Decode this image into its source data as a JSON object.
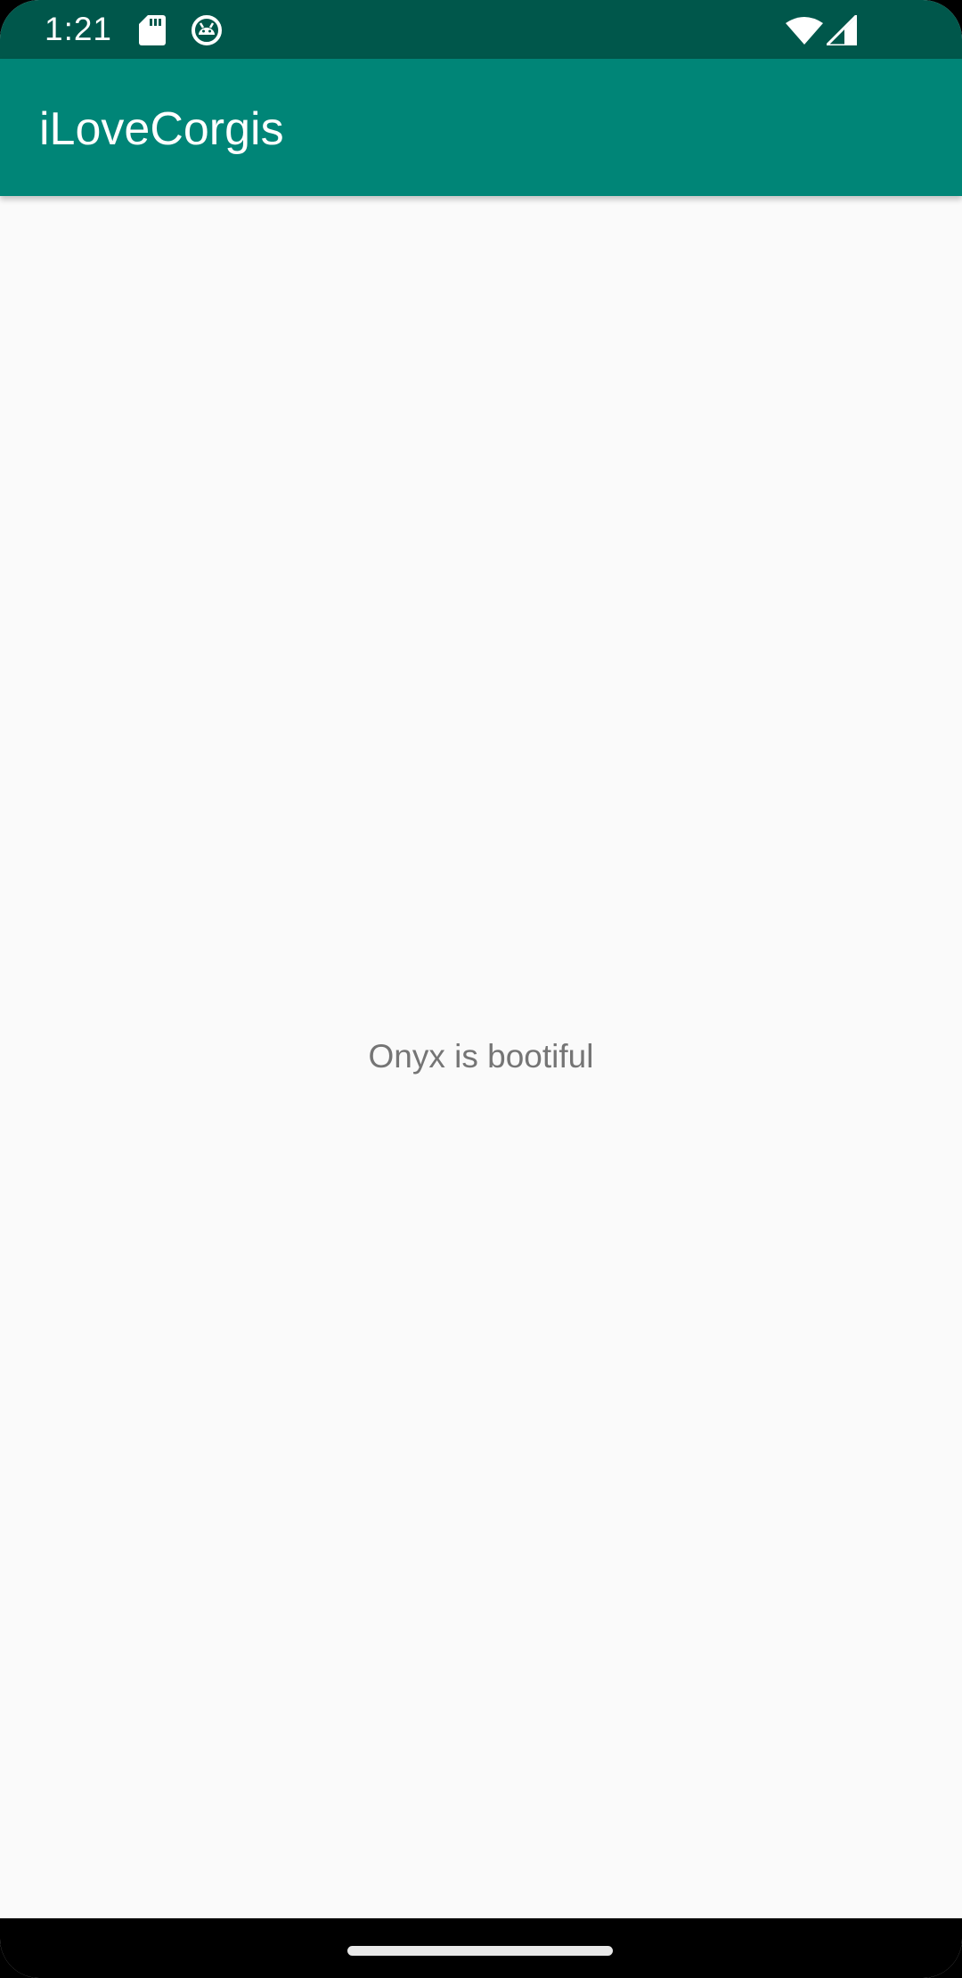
{
  "status_bar": {
    "time": "1:21",
    "icons": [
      "sd-card-icon",
      "android-debug-icon",
      "wifi-icon",
      "cell-signal-icon"
    ]
  },
  "app_bar": {
    "title": "iLoveCorgis"
  },
  "main": {
    "message": "Onyx is bootiful"
  },
  "colors": {
    "status_bar": "#00574b",
    "app_bar": "#008577",
    "background": "#fafafa",
    "body_text": "#757575"
  }
}
